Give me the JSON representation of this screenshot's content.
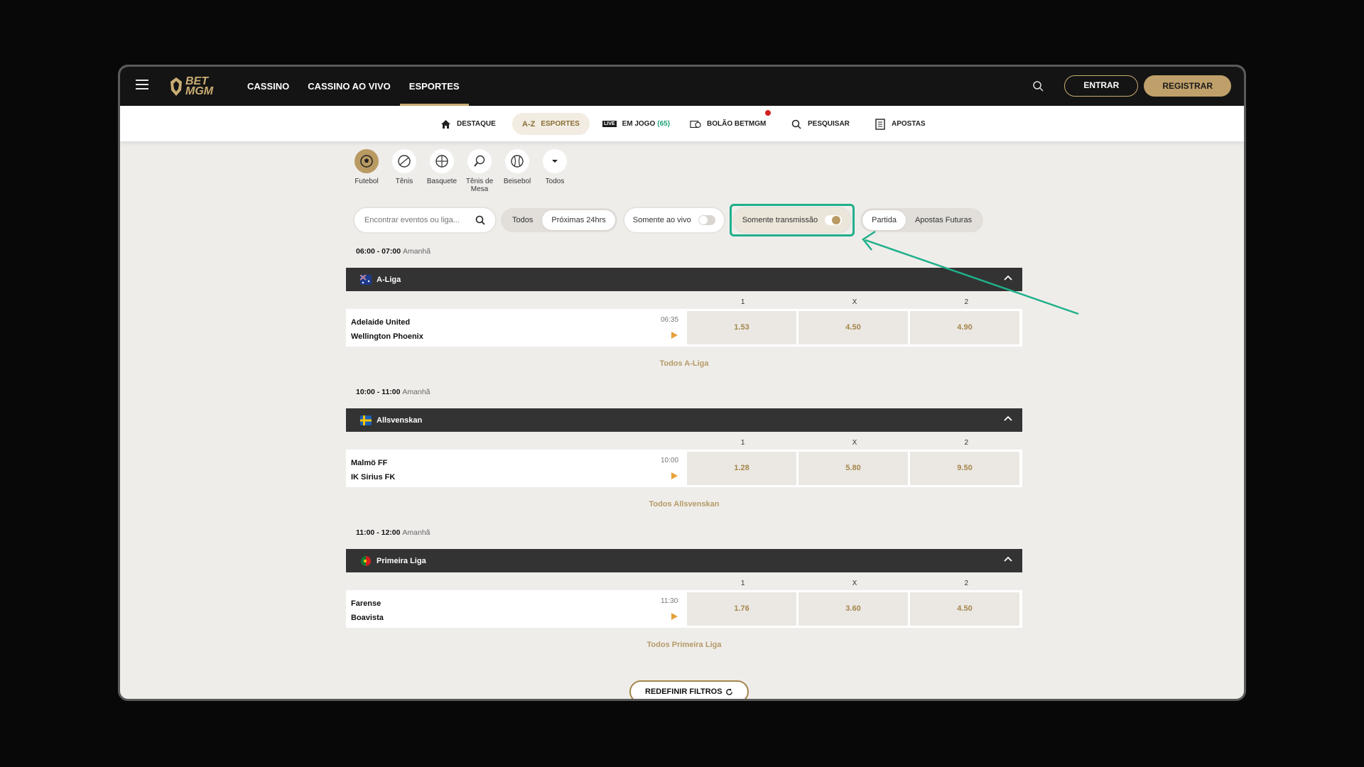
{
  "header": {
    "logo_text_1": "BET",
    "logo_text_2": "MGM",
    "nav": [
      "CASSINO",
      "CASSINO AO VIVO",
      "ESPORTES"
    ],
    "entrar": "ENTRAR",
    "registrar": "REGISTRAR"
  },
  "subnav": {
    "destaque": "DESTAQUE",
    "az": "A-Z",
    "esportes": "ESPORTES",
    "live_badge": "LIVE",
    "em_jogo": "EM JOGO",
    "em_jogo_count": "(65)",
    "bolao": "BOLÃO BETMGM",
    "pesquisar": "PESQUISAR",
    "apostas": "APOSTAS"
  },
  "sports": [
    {
      "label": "Futebol",
      "icon": "soccer-ball-icon"
    },
    {
      "label": "Tênis",
      "icon": "tennis-ball-icon"
    },
    {
      "label": "Basquete",
      "icon": "basketball-icon"
    },
    {
      "label": "Tênis de Mesa",
      "icon": "table-tennis-icon"
    },
    {
      "label": "Beisebol",
      "icon": "baseball-icon"
    },
    {
      "label": "Todos",
      "icon": "chevron-down-icon"
    }
  ],
  "filters": {
    "search_placeholder": "Encontrar eventos ou liga...",
    "todos": "Todos",
    "proximas": "Próximas 24hrs",
    "somente_ao_vivo": "Somente ao vivo",
    "somente_transmissao": "Somente transmissão",
    "partida": "Partida",
    "apostas_futuras": "Apostas Futuras"
  },
  "odds_labels": [
    "1",
    "X",
    "2"
  ],
  "sections": [
    {
      "time": "06:00 - 07:00",
      "day": "Amanhã",
      "league": "A-Liga",
      "home": "Adelaide United",
      "away": "Wellington Phoenix",
      "kickoff": "06:35",
      "odds": [
        "1.53",
        "4.50",
        "4.90"
      ],
      "all_link": "Todos A-Liga"
    },
    {
      "time": "10:00 - 11:00",
      "day": "Amanhã",
      "league": "Allsvenskan",
      "home": "Malmö FF",
      "away": "IK Sirius FK",
      "kickoff": "10:00",
      "odds": [
        "1.28",
        "5.80",
        "9.50"
      ],
      "all_link": "Todos Allsvenskan"
    },
    {
      "time": "11:00 - 12:00",
      "day": "Amanhã",
      "league": "Primeira Liga",
      "home": "Farense",
      "away": "Boavista",
      "kickoff": "11:30",
      "odds": [
        "1.76",
        "3.60",
        "4.50"
      ],
      "all_link": "Todos Primeira Liga"
    }
  ],
  "reset_label": "REDEFINIR FILTROS",
  "colors": {
    "accent": "#c9ad73",
    "annotation": "#1fb08a",
    "live_count": "#1f9e77"
  }
}
